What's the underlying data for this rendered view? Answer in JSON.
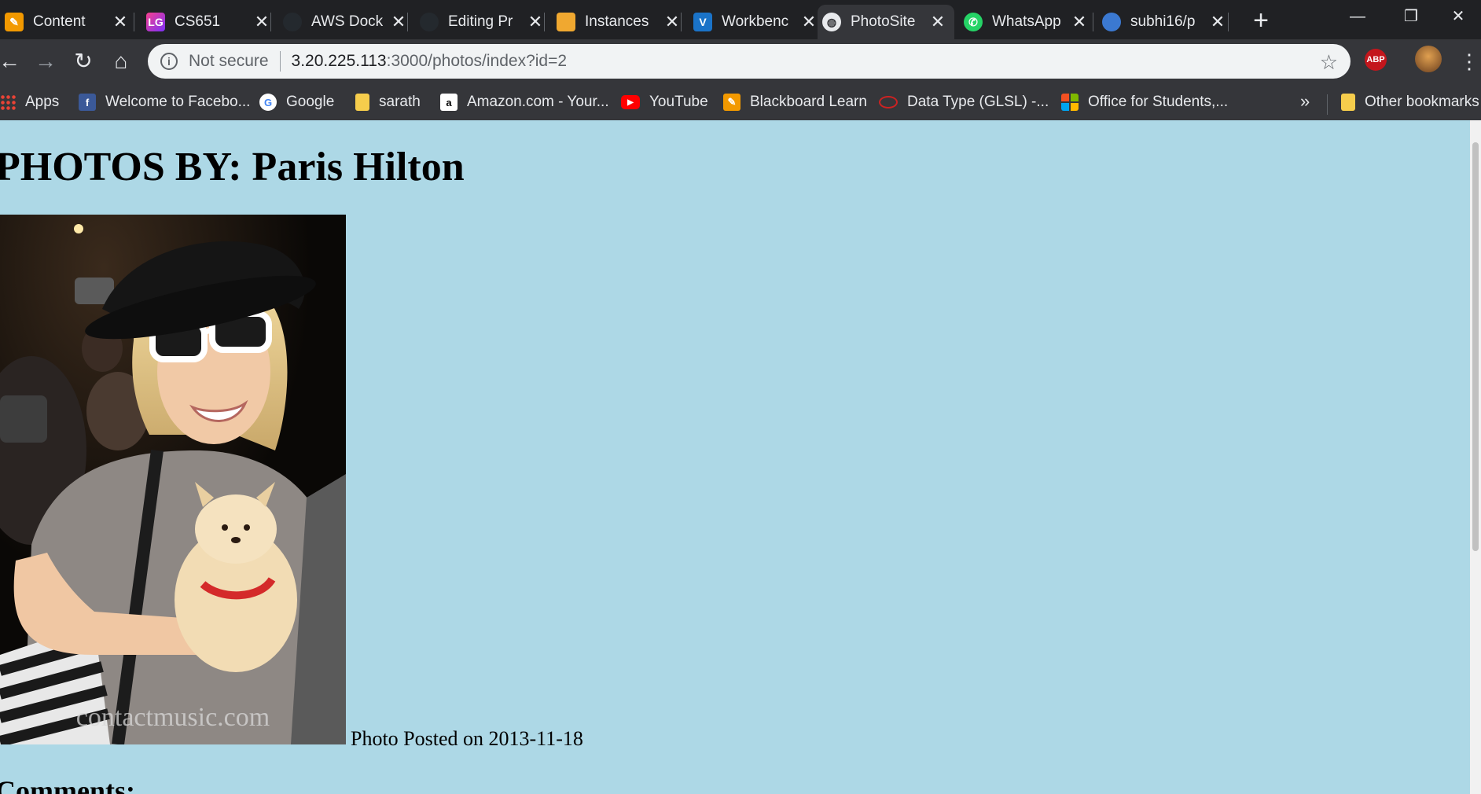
{
  "browser": {
    "tabs": [
      {
        "title": "Content",
        "icon": "edit-icon",
        "color": "#f29900"
      },
      {
        "title": "CS651",
        "icon": "lg-logo-icon",
        "color": "#7b2ff7"
      },
      {
        "title": "AWS Dock",
        "icon": "github-icon",
        "color": "#24292e"
      },
      {
        "title": "Editing Pr",
        "icon": "github-icon",
        "color": "#24292e"
      },
      {
        "title": "Instances",
        "icon": "aws-box-icon",
        "color": "#f0a830"
      },
      {
        "title": "Workbenc",
        "icon": "v-logo-icon",
        "color": "#1a73c8"
      },
      {
        "title": "PhotoSite",
        "icon": "globe-icon",
        "color": "#e8eaed",
        "active": true
      },
      {
        "title": "WhatsApp",
        "icon": "whatsapp-icon",
        "color": "#25d366"
      },
      {
        "title": "subhi16/p",
        "icon": "digitalocean-icon",
        "color": "#3b79d1"
      }
    ],
    "tab_glyphs": {
      "close": "✕",
      "new_tab": "+",
      "minimize": "—",
      "restore": "❐",
      "close_window": "✕"
    },
    "nav_glyphs": {
      "back": "←",
      "forward": "→",
      "reload": "↻",
      "home": "⌂",
      "menu": "⋮",
      "star": "☆",
      "info": "i"
    },
    "address_bar": {
      "security_label": "Not secure",
      "url_host": "3.20.225.113",
      "url_path": ":3000/photos/index?id=2"
    },
    "extensions": {
      "adblock_label": "ABP"
    },
    "bookmarks": [
      {
        "label": "Apps",
        "icon": "apps-grid-icon"
      },
      {
        "label": "Welcome to Facebo...",
        "icon": "facebook-icon",
        "glyph": "f",
        "color": "#3b5998"
      },
      {
        "label": "Google",
        "icon": "google-icon",
        "glyph": "G",
        "color": "#ffffff"
      },
      {
        "label": "sarath",
        "icon": "folder-icon"
      },
      {
        "label": "Amazon.com - Your...",
        "icon": "amazon-icon",
        "glyph": "a",
        "color": "#ffffff"
      },
      {
        "label": "YouTube",
        "icon": "youtube-icon",
        "glyph": "▶",
        "color": "#ff0000"
      },
      {
        "label": "Blackboard Learn",
        "icon": "edit-icon",
        "color": "#f29900"
      },
      {
        "label": "Data Type (GLSL) -...",
        "icon": "khronos-icon",
        "color": "#cc2222"
      },
      {
        "label": "Office for Students,...",
        "icon": "microsoft-icon"
      }
    ],
    "bookmarks_more": "»",
    "other_bookmarks": "Other bookmarks"
  },
  "page": {
    "title": "PHOTOS BY: Paris Hilton",
    "photo": {
      "watermark": "contactmusic.com"
    },
    "caption": "Photo Posted on 2013-11-18",
    "comments_heading": "Comments:"
  }
}
